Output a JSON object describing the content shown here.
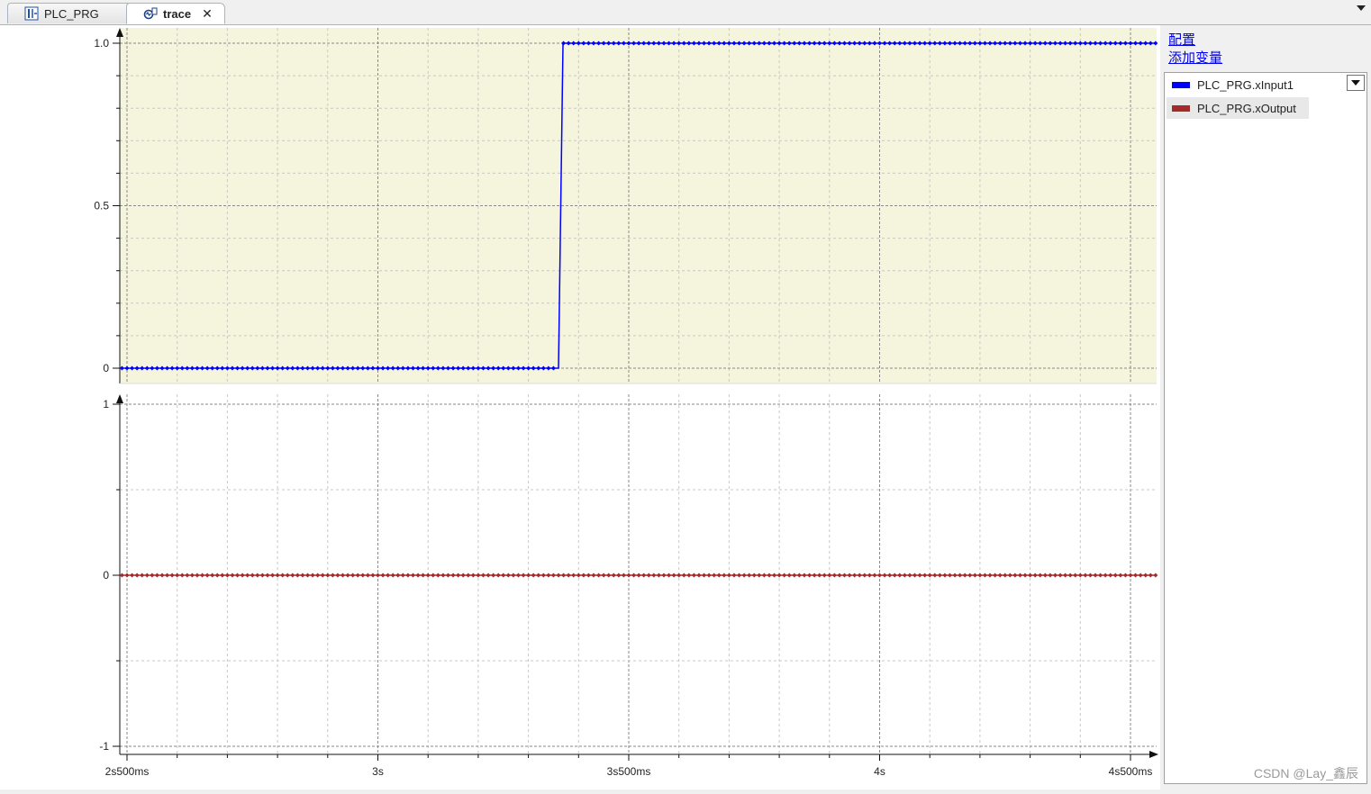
{
  "tabs": [
    {
      "label": "PLC_PRG",
      "icon": "program-icon"
    },
    {
      "label": "trace",
      "icon": "trace-icon"
    }
  ],
  "side": {
    "config_link": "配置",
    "add_var_link": "添加变量"
  },
  "legend": [
    {
      "label": "PLC_PRG.xInput1",
      "color": "#0000ff"
    },
    {
      "label": "PLC_PRG.xOutput",
      "color": "#a52a2a"
    }
  ],
  "watermark": "CSDN @Lay_鑫辰",
  "chart_data": [
    {
      "type": "line",
      "series": [
        {
          "name": "PLC_PRG.xInput1",
          "color": "#0000ff",
          "step_time_ms": 3360,
          "before": 0,
          "after": 1
        }
      ],
      "x_range_ms": [
        2500,
        4550
      ],
      "ylim": [
        0,
        1.05
      ],
      "y_ticks": [
        "0",
        "0.5",
        "1.0"
      ],
      "y_tick_values": [
        0,
        0.5,
        1.0
      ],
      "background": "#f5f4dc",
      "grid": true
    },
    {
      "type": "line",
      "series": [
        {
          "name": "PLC_PRG.xOutput",
          "color": "#a52a2a",
          "constant": 0
        }
      ],
      "x_range_ms": [
        2500,
        4550
      ],
      "ylim": [
        -1,
        1
      ],
      "y_ticks": [
        "-1",
        "0",
        "1"
      ],
      "y_tick_values": [
        -1,
        0,
        1
      ],
      "background": "#ffffff",
      "grid": true
    }
  ],
  "x_ticks": [
    "2s500ms",
    "3s",
    "3s500ms",
    "4s",
    "4s500ms"
  ],
  "x_tick_values_ms": [
    2500,
    3000,
    3500,
    4000,
    4500
  ]
}
